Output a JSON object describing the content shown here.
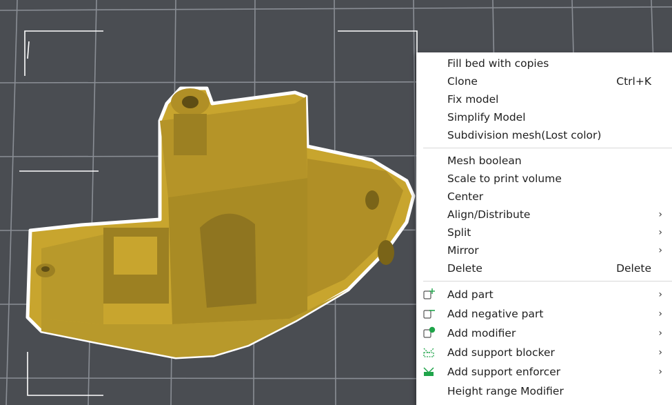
{
  "menu": {
    "group1": [
      {
        "label": "Fill bed with copies"
      },
      {
        "label": "Clone",
        "shortcut": "Ctrl+K"
      },
      {
        "label": "Fix model"
      },
      {
        "label": "Simplify Model"
      },
      {
        "label": "Subdivision mesh(Lost color)"
      }
    ],
    "group2": [
      {
        "label": "Mesh boolean"
      },
      {
        "label": "Scale to print volume"
      },
      {
        "label": "Center"
      },
      {
        "label": "Align/Distribute",
        "submenu": true
      },
      {
        "label": "Split",
        "submenu": true
      },
      {
        "label": "Mirror",
        "submenu": true
      },
      {
        "label": "Delete",
        "shortcut": "Delete"
      }
    ],
    "group3": [
      {
        "label": "Add part",
        "icon": "add-part-icon",
        "submenu": true
      },
      {
        "label": "Add negative part",
        "icon": "add-negative-part-icon",
        "submenu": true
      },
      {
        "label": "Add modifier",
        "icon": "add-modifier-icon",
        "submenu": true
      },
      {
        "label": "Add support blocker",
        "icon": "support-blocker-icon",
        "submenu": true
      },
      {
        "label": "Add support enforcer",
        "icon": "support-enforcer-icon",
        "submenu": true
      },
      {
        "label": "Height range Modifier"
      }
    ]
  },
  "colors": {
    "bed": "#4a4d52",
    "grid": "#8c9097",
    "model": "#c8a52e",
    "outline": "#ffffff",
    "accent": "#1fa44a"
  }
}
